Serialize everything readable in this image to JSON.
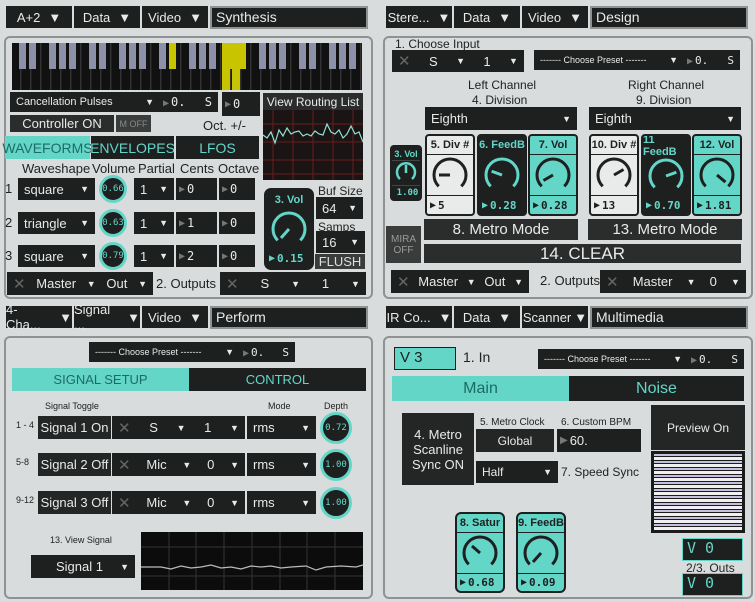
{
  "q1": {
    "tabs": [
      "A+2",
      "Data",
      "Video"
    ],
    "title": "Synthesis",
    "preset": "Cancellation Pulses",
    "preset_num": "0.",
    "preset_s": "S",
    "oct_num": "0",
    "routing": "View Routing List",
    "controller": "Controller ON",
    "moff": "M OFF",
    "oct": "Oct. +/-",
    "modes": [
      "WAVEFORMS",
      "ENVELOPES",
      "LFOS"
    ],
    "cols": [
      "Waveshape",
      "Volume",
      "Partial",
      "Cents",
      "Octave"
    ],
    "rows": [
      {
        "n": "1",
        "wave": "square",
        "vol": "0.66",
        "partial": "1",
        "cents": "0",
        "oct": "0"
      },
      {
        "n": "2",
        "wave": "triangle",
        "vol": "0.63",
        "partial": "1",
        "cents": "1",
        "oct": "0"
      },
      {
        "n": "3",
        "wave": "square",
        "vol": "0.79",
        "partial": "1",
        "cents": "2",
        "oct": "0"
      }
    ],
    "vol_label": "3. Vol",
    "vol_value": "0.15",
    "buf_label": "Buf Size",
    "buf": "64",
    "samps_label": "Samps",
    "samps": "16",
    "flush": "FLUSH",
    "out_a": "Master",
    "out_b": "Out",
    "outputs": "2.  Outputs",
    "out_c": "S",
    "out_d": "1"
  },
  "q2": {
    "tabs": [
      "Stere...",
      "Data",
      "Video"
    ],
    "title": "Design",
    "choose_input": "1. Choose Input",
    "in_a": "S",
    "in_b": "1",
    "preset": "------- Choose Preset -------",
    "preset_num": "0.",
    "preset_s": "S",
    "left": "Left Channel",
    "left_div": "4. Division",
    "right": "Right Channel",
    "right_div": "9. Division",
    "div_l": "Eighth",
    "div_r": "Eighth",
    "vol_label": "3. Vol",
    "vol_value": "1.00",
    "knobs": [
      {
        "label": "5. Div #",
        "value": "5"
      },
      {
        "label": "6. FeedB",
        "value": "0.28"
      },
      {
        "label": "7. Vol",
        "value": "0.28"
      },
      {
        "label": "10. Div #",
        "value": "13"
      },
      {
        "label": "11 FeedB",
        "value": "0.70"
      },
      {
        "label": "12. Vol",
        "value": "1.81"
      }
    ],
    "metro_l": "8. Metro Mode",
    "metro_r": "13. Metro Mode",
    "mira": "MIRA OFF",
    "clear": "14. CLEAR",
    "out_a": "Master",
    "out_b": "Out",
    "outputs": "2.  Outputs",
    "out_c": "Master",
    "out_d": "0"
  },
  "q3": {
    "tabs": [
      "4-Cha...",
      "Signal ...",
      "Video"
    ],
    "title": "Perform",
    "preset": "------- Choose Preset -------",
    "preset_num": "0.",
    "preset_s": "S",
    "tab_a": "SIGNAL SETUP",
    "tab_b": "CONTROL",
    "toggle_h": "Signal Toggle",
    "mode_h": "Mode",
    "depth_h": "Depth",
    "rows": [
      {
        "n": "1 - 4",
        "toggle": "Signal 1 On",
        "src": "S",
        "ch": "1",
        "mode": "rms",
        "depth": "0.72"
      },
      {
        "n": "5-8",
        "toggle": "Signal 2 Off",
        "src": "Mic",
        "ch": "0",
        "mode": "rms",
        "depth": "1.00"
      },
      {
        "n": "9-12",
        "toggle": "Signal 3 Off",
        "src": "Mic",
        "ch": "0",
        "mode": "rms",
        "depth": "1.00"
      }
    ],
    "view_label": "13. View Signal",
    "view": "Signal 1"
  },
  "q4": {
    "tabs": [
      "IR Co...",
      "Data",
      "Scanner"
    ],
    "title": "Multimedia",
    "in_val": "V 3",
    "in_label": "1. In",
    "preset": "------- Choose Preset -------",
    "preset_num": "0.",
    "preset_s": "S",
    "tab_a": "Main",
    "tab_b": "Noise",
    "metro": "4. Metro Scanline Sync ON",
    "clock_label": "5. Metro Clock",
    "clock": "Global",
    "bpm_label": "6. Custom BPM",
    "bpm": "60.",
    "speed": "Half",
    "speed_label": "7. Speed Sync",
    "preview": "Preview On",
    "satur_label": "8. Satur",
    "satur": "0.68",
    "feedb_label": "9. FeedB",
    "feedb": "0.09",
    "out1": "V 0",
    "outs_label": "2/3. Outs",
    "out2": "V 0"
  },
  "colors": {
    "accent": "#63d6c8",
    "dark": "#1e2020",
    "bg": "#d9dcdc",
    "key_highlight": "#c9c400"
  }
}
